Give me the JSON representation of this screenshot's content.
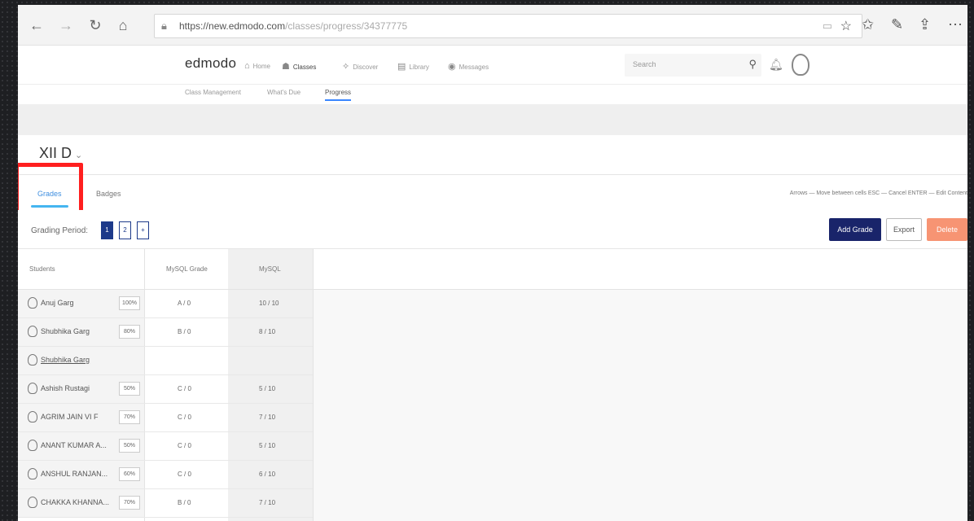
{
  "browser": {
    "url_host": "https://new.edmodo.com",
    "url_path": "/classes/progress/34377775",
    "icons": [
      "back-arrow-icon",
      "forward-arrow-icon",
      "refresh-icon",
      "home-icon",
      "lock-icon",
      "reader-icon",
      "star-icon",
      "favorites-icon",
      "pen-icon",
      "share-icon",
      "more-icon"
    ]
  },
  "header": {
    "logo": "edmodo",
    "nav": [
      {
        "label": "Home",
        "icon": "home-icon"
      },
      {
        "label": "Classes",
        "icon": "classes-icon"
      },
      {
        "label": "Discover",
        "icon": "discover-icon"
      },
      {
        "label": "Library",
        "icon": "library-icon"
      },
      {
        "label": "Messages",
        "icon": "messages-icon"
      }
    ],
    "search_placeholder": "Search"
  },
  "subnav": [
    "Class Management",
    "What's Due",
    "Progress"
  ],
  "class_name": "XII D",
  "tabs": [
    "Grades",
    "Badges"
  ],
  "shortcuts": "Arrows — Move between cells   ESC — Cancel   ENTER — Edit Content",
  "grading": {
    "label": "Grading Period:",
    "periods": [
      "1",
      "2",
      "+"
    ]
  },
  "actions": {
    "add_grade": "Add Grade",
    "export": "Export",
    "delete": "Delete"
  },
  "table": {
    "headers": [
      "Students",
      "MySQL Grade",
      "MySQL"
    ],
    "rows": [
      {
        "name": "Anuj Garg",
        "pct": "100%",
        "grade": "A / 0",
        "score": "10 / 10"
      },
      {
        "name": "Shubhika Garg",
        "pct": "80%",
        "grade": "B / 0",
        "score": "8 / 10"
      },
      {
        "name": "Shubhika Garg",
        "pct": "",
        "grade": "",
        "score": ""
      },
      {
        "name": "Ashish Rustagi",
        "pct": "50%",
        "grade": "C / 0",
        "score": "5 / 10"
      },
      {
        "name": "AGRIM JAIN VI F",
        "pct": "70%",
        "grade": "C / 0",
        "score": "7 / 10"
      },
      {
        "name": "ANANT KUMAR A...",
        "pct": "50%",
        "grade": "C / 0",
        "score": "5 / 10"
      },
      {
        "name": "ANSHUL RANJAN...",
        "pct": "60%",
        "grade": "C / 0",
        "score": "6 / 10"
      },
      {
        "name": "CHAKKA KHANNA...",
        "pct": "70%",
        "grade": "B / 0",
        "score": "7 / 10"
      }
    ]
  },
  "colors": {
    "add_grade": "#19246a",
    "delete": "#f79473",
    "tab_active": "#45b5f0",
    "highlight": "#ff1f1f"
  }
}
